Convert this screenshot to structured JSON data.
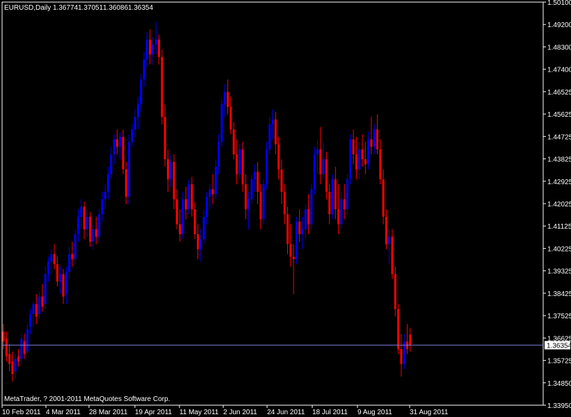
{
  "chart_header": {
    "symbol": "EURUSD,Daily",
    "open": "1.36774",
    "high": "1.37051",
    "low": "1.36086",
    "close": "1.36354"
  },
  "copyright": "MetaTrader, ? 2001-2011 MetaQuotes Software Corp.",
  "current_price_label": "1.36354",
  "colors": {
    "background": "#000000",
    "frame": "#ffffff",
    "bull": "#0000ff",
    "bear": "#ff0000",
    "bid_line": "#7b7bd6",
    "text": "#ffffff"
  },
  "chart_data": {
    "type": "candlestick",
    "timeframe": "Daily",
    "ylim": [
      1.3395,
      1.501
    ],
    "y_ticks": [
      "1.50100",
      "1.49200",
      "1.48300",
      "1.47400",
      "1.46525",
      "1.45625",
      "1.44725",
      "1.43825",
      "1.42925",
      "1.42025",
      "1.41125",
      "1.40225",
      "1.39325",
      "1.38425",
      "1.37525",
      "1.36625",
      "1.35725",
      "1.34850",
      "1.33950"
    ],
    "x_ticks": [
      "10 Feb 2011",
      "4 Mar 2011",
      "28 Mar 2011",
      "19 Apr 2011",
      "11 May 2011",
      "2 Jun 2011",
      "24 Jun 2011",
      "18 Jul 2011",
      "9 Aug 2011",
      "31 Aug 2011"
    ],
    "current_price": 1.36354,
    "candles": [
      {
        "o": 1.369,
        "h": 1.372,
        "l": 1.362,
        "c": 1.365
      },
      {
        "o": 1.366,
        "h": 1.369,
        "l": 1.357,
        "c": 1.359
      },
      {
        "o": 1.36,
        "h": 1.364,
        "l": 1.353,
        "c": 1.356
      },
      {
        "o": 1.357,
        "h": 1.361,
        "l": 1.349,
        "c": 1.352
      },
      {
        "o": 1.353,
        "h": 1.36,
        "l": 1.35,
        "c": 1.358
      },
      {
        "o": 1.359,
        "h": 1.362,
        "l": 1.355,
        "c": 1.357
      },
      {
        "o": 1.358,
        "h": 1.368,
        "l": 1.356,
        "c": 1.366
      },
      {
        "o": 1.365,
        "h": 1.368,
        "l": 1.358,
        "c": 1.36
      },
      {
        "o": 1.361,
        "h": 1.372,
        "l": 1.36,
        "c": 1.37
      },
      {
        "o": 1.371,
        "h": 1.378,
        "l": 1.368,
        "c": 1.376
      },
      {
        "o": 1.376,
        "h": 1.381,
        "l": 1.371,
        "c": 1.38
      },
      {
        "o": 1.38,
        "h": 1.384,
        "l": 1.372,
        "c": 1.375
      },
      {
        "o": 1.376,
        "h": 1.385,
        "l": 1.374,
        "c": 1.383
      },
      {
        "o": 1.383,
        "h": 1.388,
        "l": 1.377,
        "c": 1.379
      },
      {
        "o": 1.38,
        "h": 1.395,
        "l": 1.378,
        "c": 1.392
      },
      {
        "o": 1.392,
        "h": 1.399,
        "l": 1.389,
        "c": 1.397
      },
      {
        "o": 1.397,
        "h": 1.402,
        "l": 1.392,
        "c": 1.4
      },
      {
        "o": 1.4,
        "h": 1.404,
        "l": 1.394,
        "c": 1.396
      },
      {
        "o": 1.396,
        "h": 1.399,
        "l": 1.387,
        "c": 1.389
      },
      {
        "o": 1.389,
        "h": 1.395,
        "l": 1.384,
        "c": 1.392
      },
      {
        "o": 1.392,
        "h": 1.394,
        "l": 1.38,
        "c": 1.383
      },
      {
        "o": 1.384,
        "h": 1.395,
        "l": 1.38,
        "c": 1.393
      },
      {
        "o": 1.393,
        "h": 1.403,
        "l": 1.39,
        "c": 1.4
      },
      {
        "o": 1.4,
        "h": 1.405,
        "l": 1.395,
        "c": 1.398
      },
      {
        "o": 1.398,
        "h": 1.41,
        "l": 1.396,
        "c": 1.408
      },
      {
        "o": 1.408,
        "h": 1.418,
        "l": 1.405,
        "c": 1.415
      },
      {
        "o": 1.415,
        "h": 1.422,
        "l": 1.41,
        "c": 1.419
      },
      {
        "o": 1.419,
        "h": 1.421,
        "l": 1.406,
        "c": 1.41
      },
      {
        "o": 1.41,
        "h": 1.418,
        "l": 1.407,
        "c": 1.415
      },
      {
        "o": 1.415,
        "h": 1.417,
        "l": 1.403,
        "c": 1.405
      },
      {
        "o": 1.405,
        "h": 1.412,
        "l": 1.402,
        "c": 1.41
      },
      {
        "o": 1.41,
        "h": 1.415,
        "l": 1.404,
        "c": 1.407
      },
      {
        "o": 1.407,
        "h": 1.418,
        "l": 1.405,
        "c": 1.416
      },
      {
        "o": 1.416,
        "h": 1.425,
        "l": 1.413,
        "c": 1.422
      },
      {
        "o": 1.422,
        "h": 1.428,
        "l": 1.418,
        "c": 1.425
      },
      {
        "o": 1.425,
        "h": 1.435,
        "l": 1.422,
        "c": 1.432
      },
      {
        "o": 1.432,
        "h": 1.443,
        "l": 1.43,
        "c": 1.44
      },
      {
        "o": 1.44,
        "h": 1.448,
        "l": 1.436,
        "c": 1.446
      },
      {
        "o": 1.446,
        "h": 1.45,
        "l": 1.44,
        "c": 1.443
      },
      {
        "o": 1.443,
        "h": 1.449,
        "l": 1.438,
        "c": 1.447
      },
      {
        "o": 1.447,
        "h": 1.45,
        "l": 1.432,
        "c": 1.434
      },
      {
        "o": 1.434,
        "h": 1.437,
        "l": 1.42,
        "c": 1.423
      },
      {
        "o": 1.423,
        "h": 1.448,
        "l": 1.42,
        "c": 1.445
      },
      {
        "o": 1.445,
        "h": 1.452,
        "l": 1.443,
        "c": 1.45
      },
      {
        "o": 1.45,
        "h": 1.458,
        "l": 1.447,
        "c": 1.455
      },
      {
        "o": 1.455,
        "h": 1.463,
        "l": 1.45,
        "c": 1.46
      },
      {
        "o": 1.46,
        "h": 1.472,
        "l": 1.457,
        "c": 1.47
      },
      {
        "o": 1.47,
        "h": 1.481,
        "l": 1.467,
        "c": 1.478
      },
      {
        "o": 1.478,
        "h": 1.489,
        "l": 1.475,
        "c": 1.486
      },
      {
        "o": 1.486,
        "h": 1.49,
        "l": 1.476,
        "c": 1.48
      },
      {
        "o": 1.48,
        "h": 1.487,
        "l": 1.476,
        "c": 1.484
      },
      {
        "o": 1.484,
        "h": 1.493,
        "l": 1.48,
        "c": 1.486
      },
      {
        "o": 1.486,
        "h": 1.488,
        "l": 1.476,
        "c": 1.479
      },
      {
        "o": 1.479,
        "h": 1.482,
        "l": 1.452,
        "c": 1.455
      },
      {
        "o": 1.455,
        "h": 1.46,
        "l": 1.435,
        "c": 1.438
      },
      {
        "o": 1.438,
        "h": 1.442,
        "l": 1.425,
        "c": 1.43
      },
      {
        "o": 1.43,
        "h": 1.44,
        "l": 1.427,
        "c": 1.437
      },
      {
        "o": 1.437,
        "h": 1.44,
        "l": 1.418,
        "c": 1.422
      },
      {
        "o": 1.422,
        "h": 1.426,
        "l": 1.41,
        "c": 1.412
      },
      {
        "o": 1.412,
        "h": 1.418,
        "l": 1.405,
        "c": 1.408
      },
      {
        "o": 1.408,
        "h": 1.425,
        "l": 1.406,
        "c": 1.422
      },
      {
        "o": 1.422,
        "h": 1.427,
        "l": 1.414,
        "c": 1.418
      },
      {
        "o": 1.418,
        "h": 1.43,
        "l": 1.416,
        "c": 1.428
      },
      {
        "o": 1.428,
        "h": 1.431,
        "l": 1.415,
        "c": 1.418
      },
      {
        "o": 1.418,
        "h": 1.421,
        "l": 1.406,
        "c": 1.408
      },
      {
        "o": 1.408,
        "h": 1.412,
        "l": 1.398,
        "c": 1.402
      },
      {
        "o": 1.402,
        "h": 1.41,
        "l": 1.397,
        "c": 1.406
      },
      {
        "o": 1.406,
        "h": 1.418,
        "l": 1.404,
        "c": 1.415
      },
      {
        "o": 1.415,
        "h": 1.425,
        "l": 1.412,
        "c": 1.423
      },
      {
        "o": 1.423,
        "h": 1.428,
        "l": 1.418,
        "c": 1.426
      },
      {
        "o": 1.426,
        "h": 1.432,
        "l": 1.42,
        "c": 1.424
      },
      {
        "o": 1.424,
        "h": 1.438,
        "l": 1.422,
        "c": 1.435
      },
      {
        "o": 1.435,
        "h": 1.448,
        "l": 1.432,
        "c": 1.445
      },
      {
        "o": 1.445,
        "h": 1.462,
        "l": 1.443,
        "c": 1.46
      },
      {
        "o": 1.46,
        "h": 1.468,
        "l": 1.455,
        "c": 1.465
      },
      {
        "o": 1.465,
        "h": 1.47,
        "l": 1.456,
        "c": 1.459
      },
      {
        "o": 1.459,
        "h": 1.463,
        "l": 1.448,
        "c": 1.45
      },
      {
        "o": 1.45,
        "h": 1.453,
        "l": 1.438,
        "c": 1.44
      },
      {
        "o": 1.44,
        "h": 1.446,
        "l": 1.428,
        "c": 1.432
      },
      {
        "o": 1.432,
        "h": 1.444,
        "l": 1.43,
        "c": 1.442
      },
      {
        "o": 1.442,
        "h": 1.445,
        "l": 1.425,
        "c": 1.428
      },
      {
        "o": 1.428,
        "h": 1.432,
        "l": 1.414,
        "c": 1.418
      },
      {
        "o": 1.418,
        "h": 1.425,
        "l": 1.41,
        "c": 1.422
      },
      {
        "o": 1.422,
        "h": 1.432,
        "l": 1.42,
        "c": 1.43
      },
      {
        "o": 1.43,
        "h": 1.436,
        "l": 1.425,
        "c": 1.433
      },
      {
        "o": 1.433,
        "h": 1.437,
        "l": 1.42,
        "c": 1.425
      },
      {
        "o": 1.425,
        "h": 1.428,
        "l": 1.41,
        "c": 1.414
      },
      {
        "o": 1.414,
        "h": 1.43,
        "l": 1.412,
        "c": 1.428
      },
      {
        "o": 1.428,
        "h": 1.445,
        "l": 1.426,
        "c": 1.442
      },
      {
        "o": 1.442,
        "h": 1.455,
        "l": 1.44,
        "c": 1.452
      },
      {
        "o": 1.452,
        "h": 1.458,
        "l": 1.446,
        "c": 1.454
      },
      {
        "o": 1.454,
        "h": 1.457,
        "l": 1.44,
        "c": 1.444
      },
      {
        "o": 1.444,
        "h": 1.447,
        "l": 1.43,
        "c": 1.434
      },
      {
        "o": 1.434,
        "h": 1.438,
        "l": 1.42,
        "c": 1.425
      },
      {
        "o": 1.425,
        "h": 1.428,
        "l": 1.412,
        "c": 1.416
      },
      {
        "o": 1.416,
        "h": 1.419,
        "l": 1.4,
        "c": 1.404
      },
      {
        "o": 1.404,
        "h": 1.412,
        "l": 1.395,
        "c": 1.399
      },
      {
        "o": 1.399,
        "h": 1.404,
        "l": 1.384,
        "c": 1.398
      },
      {
        "o": 1.398,
        "h": 1.415,
        "l": 1.396,
        "c": 1.413
      },
      {
        "o": 1.413,
        "h": 1.418,
        "l": 1.405,
        "c": 1.408
      },
      {
        "o": 1.408,
        "h": 1.415,
        "l": 1.402,
        "c": 1.41
      },
      {
        "o": 1.41,
        "h": 1.42,
        "l": 1.406,
        "c": 1.418
      },
      {
        "o": 1.418,
        "h": 1.424,
        "l": 1.408,
        "c": 1.412
      },
      {
        "o": 1.412,
        "h": 1.428,
        "l": 1.41,
        "c": 1.426
      },
      {
        "o": 1.426,
        "h": 1.443,
        "l": 1.424,
        "c": 1.44
      },
      {
        "o": 1.44,
        "h": 1.446,
        "l": 1.432,
        "c": 1.442
      },
      {
        "o": 1.442,
        "h": 1.451,
        "l": 1.428,
        "c": 1.432
      },
      {
        "o": 1.432,
        "h": 1.445,
        "l": 1.43,
        "c": 1.438
      },
      {
        "o": 1.438,
        "h": 1.441,
        "l": 1.422,
        "c": 1.425
      },
      {
        "o": 1.425,
        "h": 1.428,
        "l": 1.412,
        "c": 1.416
      },
      {
        "o": 1.416,
        "h": 1.432,
        "l": 1.414,
        "c": 1.43
      },
      {
        "o": 1.43,
        "h": 1.435,
        "l": 1.414,
        "c": 1.418
      },
      {
        "o": 1.418,
        "h": 1.428,
        "l": 1.408,
        "c": 1.412
      },
      {
        "o": 1.412,
        "h": 1.425,
        "l": 1.41,
        "c": 1.422
      },
      {
        "o": 1.422,
        "h": 1.428,
        "l": 1.414,
        "c": 1.418
      },
      {
        "o": 1.418,
        "h": 1.432,
        "l": 1.416,
        "c": 1.43
      },
      {
        "o": 1.43,
        "h": 1.448,
        "l": 1.428,
        "c": 1.446
      },
      {
        "o": 1.446,
        "h": 1.45,
        "l": 1.436,
        "c": 1.44
      },
      {
        "o": 1.44,
        "h": 1.447,
        "l": 1.43,
        "c": 1.434
      },
      {
        "o": 1.434,
        "h": 1.445,
        "l": 1.43,
        "c": 1.442
      },
      {
        "o": 1.442,
        "h": 1.448,
        "l": 1.435,
        "c": 1.438
      },
      {
        "o": 1.438,
        "h": 1.445,
        "l": 1.432,
        "c": 1.436
      },
      {
        "o": 1.436,
        "h": 1.449,
        "l": 1.434,
        "c": 1.446
      },
      {
        "o": 1.446,
        "h": 1.455,
        "l": 1.44,
        "c": 1.443
      },
      {
        "o": 1.443,
        "h": 1.452,
        "l": 1.44,
        "c": 1.45
      },
      {
        "o": 1.45,
        "h": 1.456,
        "l": 1.44,
        "c": 1.442
      },
      {
        "o": 1.442,
        "h": 1.446,
        "l": 1.428,
        "c": 1.43
      },
      {
        "o": 1.43,
        "h": 1.434,
        "l": 1.412,
        "c": 1.415
      },
      {
        "o": 1.415,
        "h": 1.418,
        "l": 1.402,
        "c": 1.404
      },
      {
        "o": 1.404,
        "h": 1.41,
        "l": 1.396,
        "c": 1.407
      },
      {
        "o": 1.407,
        "h": 1.41,
        "l": 1.39,
        "c": 1.392
      },
      {
        "o": 1.392,
        "h": 1.395,
        "l": 1.375,
        "c": 1.378
      },
      {
        "o": 1.378,
        "h": 1.38,
        "l": 1.36,
        "c": 1.362
      },
      {
        "o": 1.362,
        "h": 1.368,
        "l": 1.351,
        "c": 1.356
      },
      {
        "o": 1.356,
        "h": 1.368,
        "l": 1.354,
        "c": 1.365
      },
      {
        "o": 1.365,
        "h": 1.372,
        "l": 1.36,
        "c": 1.362
      },
      {
        "o": 1.36774,
        "h": 1.37051,
        "l": 1.36086,
        "c": 1.36354
      }
    ]
  }
}
